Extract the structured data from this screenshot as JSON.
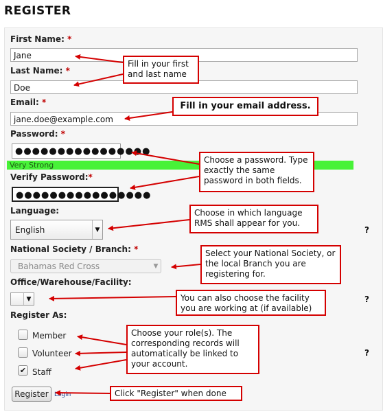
{
  "page": {
    "title": "REGISTER"
  },
  "form": {
    "first_name": {
      "label": "First Name:",
      "required": "*",
      "value": "Jane"
    },
    "last_name": {
      "label": "Last Name:",
      "required": "*",
      "value": "Doe"
    },
    "email": {
      "label": "Email:",
      "required": "*",
      "value": "jane.doe@example.com"
    },
    "password": {
      "label": "Password:",
      "required": "*",
      "value": "●●●●●●●●●●●●●●●●",
      "strength": "Very Strong"
    },
    "verify_password": {
      "label": "Verify Password:",
      "required": "*",
      "value": "●●●●●●●●●●●●●●●●"
    },
    "language": {
      "label": "Language:",
      "value": "English",
      "help": "?"
    },
    "national_society": {
      "label": "National Society / Branch:",
      "required": "*",
      "value": "Bahamas Red Cross"
    },
    "facility": {
      "label": "Office/Warehouse/Facility:",
      "value": "",
      "help": "?"
    },
    "register_as": {
      "label": "Register As:",
      "help": "?",
      "options": [
        {
          "label": "Member",
          "checked": false
        },
        {
          "label": "Volunteer",
          "checked": false
        },
        {
          "label": "Staff",
          "checked": true
        }
      ]
    },
    "register_button": "Register",
    "login_link": "Login"
  },
  "annotations": {
    "name": "Fill in your first and last name",
    "email": "Fill in your email address.",
    "password": "Choose a password. Type exactly the same password in both fields.",
    "language": "Choose in which language RMS shall appear for you.",
    "society": "Select your National Society, or the local Branch you are registering for.",
    "facility": "You can also choose the facility you are working at (if available)",
    "roles": "Choose your role(s). The corresponding records will automatically be linked to your account.",
    "register": "Click \"Register\" when done"
  },
  "colors": {
    "annotation": "#d40000",
    "strength_bar": "#48f238",
    "required": "#c00000"
  }
}
